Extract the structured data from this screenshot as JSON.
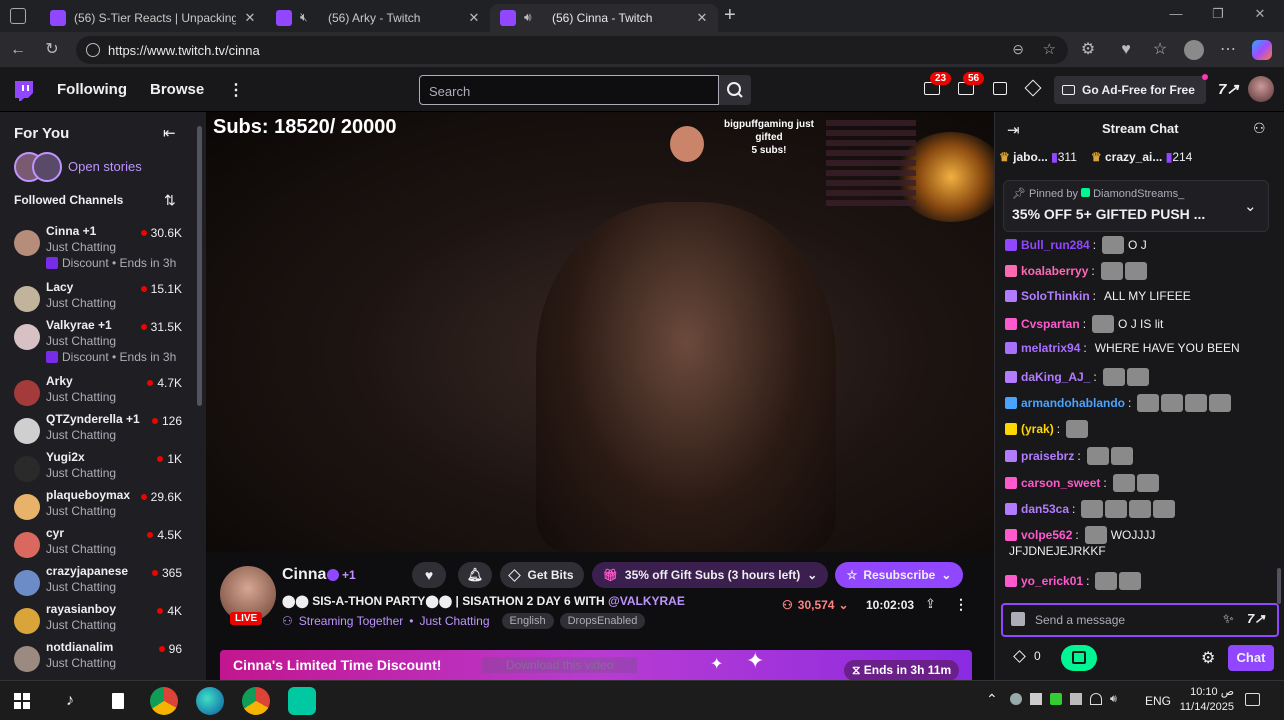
{
  "browser": {
    "tabs": [
      {
        "title": "(56) S-Tier Reacts | Unpacking Dra",
        "active": false
      },
      {
        "title": "(56) Arky - Twitch",
        "active": false
      },
      {
        "title": "(56) Cinna - Twitch",
        "active": true
      }
    ],
    "url": "https://www.twitch.tv/cinna"
  },
  "topnav": {
    "following": "Following",
    "browse": "Browse",
    "search_placeholder": "Search",
    "notif_count": "23",
    "whisper_count": "56",
    "ad_free": "Go Ad-Free for Free"
  },
  "sidebar": {
    "title": "For You",
    "stories": "Open stories",
    "followed": "Followed Channels",
    "channels": [
      {
        "name": "Cinna +1",
        "category": "Just Chatting",
        "viewers": "30.6K",
        "extra": "Discount • Ends in 3h"
      },
      {
        "name": "Lacy",
        "category": "Just Chatting",
        "viewers": "15.1K"
      },
      {
        "name": "Valkyrae +1",
        "category": "Just Chatting",
        "viewers": "31.5K",
        "extra": "Discount • Ends in 3h"
      },
      {
        "name": "Arky",
        "category": "Just Chatting",
        "viewers": "4.7K"
      },
      {
        "name": "QTZynderella +1",
        "category": "Just Chatting",
        "viewers": "126"
      },
      {
        "name": "Yugi2x",
        "category": "Just Chatting",
        "viewers": "1K"
      },
      {
        "name": "plaqueboymax",
        "category": "Just Chatting",
        "viewers": "29.6K"
      },
      {
        "name": "cyr",
        "category": "Just Chatting",
        "viewers": "4.5K"
      },
      {
        "name": "crazyjapanese",
        "category": "Just Chatting",
        "viewers": "365"
      },
      {
        "name": "rayasianboy",
        "category": "Just Chatting",
        "viewers": "4K"
      },
      {
        "name": "notdianalim",
        "category": "Just Chatting",
        "viewers": "96"
      }
    ]
  },
  "video": {
    "subs_overlay": "Subs: 18520/ 20000",
    "gift_alert": [
      "bigpuffgaming just",
      "gifted",
      "5 subs!"
    ]
  },
  "stream": {
    "streamer": "Cinna",
    "plus": "+1",
    "live": "LIVE",
    "title_prefix": "SIS-A-THON PARTY",
    "title_rest": "| SISATHON 2 DAY 6 WITH",
    "mention": "@VALKYRAE",
    "together": "Streaming Together",
    "category": "Just Chatting",
    "tags": [
      "English",
      "DropsEnabled"
    ],
    "get_bits": "Get Bits",
    "gift_subs": "35% off Gift Subs (3 hours left)",
    "resubscribe": "Resubscribe",
    "viewers": "30,574",
    "uptime": "10:02:03",
    "discount_banner": "Cinna's Limited Time Discount!",
    "download_hint": "Download this video",
    "ends_in": "Ends in 3h 11m"
  },
  "chat": {
    "title": "Stream Chat",
    "leaders": [
      {
        "name": "jabo...",
        "count": "311"
      },
      {
        "name": "crazy_ai...",
        "count": "214"
      }
    ],
    "pinned_by": "Pinned by",
    "pinned_user": "DiamondStreams_",
    "pinned_text": "35% OFF 5+ GIFTED PUSH ...",
    "messages": [
      {
        "user": "Bull_run284",
        "text": "O J",
        "color": "#9147ff"
      },
      {
        "user": "koalaberryy",
        "text": "",
        "color": "#ff69b4"
      },
      {
        "user": "SoloThinkin",
        "text": "ALL MY LIFEEE",
        "color": "#b37cff"
      },
      {
        "user": "Cvspartan",
        "text": "O J   IS lit",
        "color": "#ff5acd"
      },
      {
        "user": "melatrix94",
        "text": "WHERE HAVE YOU BEEN",
        "color": "#a970ff"
      },
      {
        "user": "daKing_AJ_",
        "text": "",
        "color": "#b37cff"
      },
      {
        "user": "armandohablando",
        "text": "",
        "color": "#4aa3ff"
      },
      {
        "user": "(yrak)",
        "text": "",
        "color": "#ffd700"
      },
      {
        "user": "praisebrz",
        "text": "",
        "color": "#b37cff"
      },
      {
        "user": "carson_sweet",
        "text": "",
        "color": "#ff5acd"
      },
      {
        "user": "dan53ca",
        "text": "",
        "color": "#b37cff"
      },
      {
        "user": "volpe562",
        "text": "WOJJJJ",
        "color": "#ff5acd"
      },
      {
        "user": "",
        "text": "JFJDNEJEJRKKF",
        "color": "#efeff1"
      },
      {
        "user": "yo_erick01",
        "text": "",
        "color": "#ff5acd"
      }
    ],
    "input_placeholder": "Send a message",
    "points": "0",
    "chat_button": "Chat"
  },
  "taskbar": {
    "lang": "ENG",
    "time": "10:10 ص",
    "date": "11/14/2025"
  },
  "colors": {
    "accent": "#9147ff",
    "live": "#eb0400",
    "chat_green": "#00f593"
  }
}
